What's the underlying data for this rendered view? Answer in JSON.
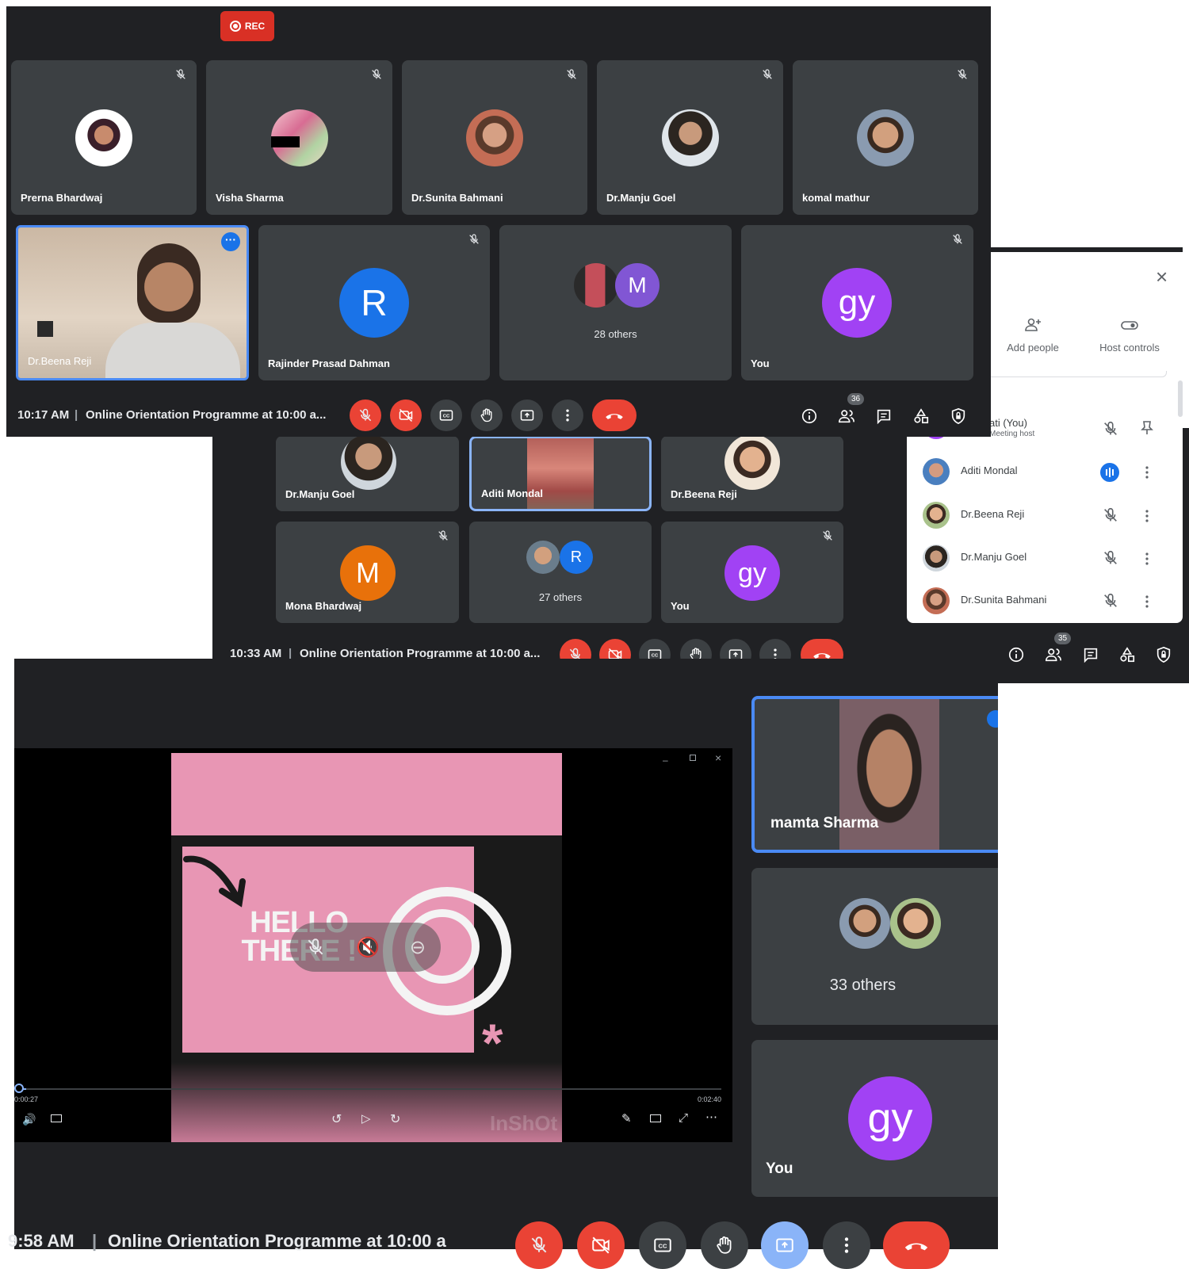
{
  "shot1": {
    "rec_label": "REC",
    "tiles": [
      {
        "name": "Prerna Bhardwaj"
      },
      {
        "name": "Visha Sharma"
      },
      {
        "name": "Dr.Sunita Bahmani"
      },
      {
        "name": "Dr.Manju Goel"
      },
      {
        "name": "komal mathur"
      }
    ],
    "featured": {
      "name": "Dr.Beena Reji"
    },
    "rajinder": {
      "name": "Rajinder Prasad Dahman",
      "initial": "R"
    },
    "others": {
      "initial": "M",
      "label": "28 others"
    },
    "you": {
      "name": "You",
      "initial": "gy"
    },
    "time": "10:17 AM",
    "separator": "|",
    "meeting": "Online Orientation Programme at 10:00 a...",
    "people_count": "36"
  },
  "shot2": {
    "tiles": [
      {
        "name": "Dr.Manju Goel"
      },
      {
        "name": "Aditi Mondal"
      },
      {
        "name": "Dr.Beena Reji"
      }
    ],
    "mona": {
      "name": "Mona Bhardwaj",
      "initial": "M"
    },
    "others": {
      "initial": "R",
      "label": "27 others"
    },
    "you": {
      "name": "You",
      "initial": "gy"
    },
    "time": "10:33 AM",
    "separator": "|",
    "meeting": "Online Orientation Programme at 10:00 a...",
    "people_count": "35"
  },
  "panel": {
    "add_people": "Add people",
    "host_controls": "Host controls",
    "you_row": "ati (You)",
    "you_sub": "Meeting host",
    "participants": [
      "Aditi Mondal",
      "Dr.Beena Reji",
      "Dr.Manju Goel",
      "Dr.Sunita Bahmani"
    ]
  },
  "shot3": {
    "video": {
      "headline": "HELLO THERE !",
      "time_current": "0:00:27",
      "time_total": "0:02:40",
      "watermark": "InShOt",
      "progress": 0.01
    },
    "featured": {
      "name": "mamta Sharma"
    },
    "others": {
      "label": "33 others"
    },
    "you": {
      "name": "You",
      "initial": "gy"
    },
    "time": "9:58 AM",
    "separator": "|",
    "meeting": "Online Orientation Programme at 10:00 a"
  },
  "colors": {
    "bg_dark": "#202124",
    "tile": "#3c4043",
    "red": "#ea4335",
    "blue_avatar": "#1a73e8",
    "purple_avatar": "#a142f4",
    "orange_avatar": "#e8710a",
    "pink_video": "#e896b4"
  }
}
